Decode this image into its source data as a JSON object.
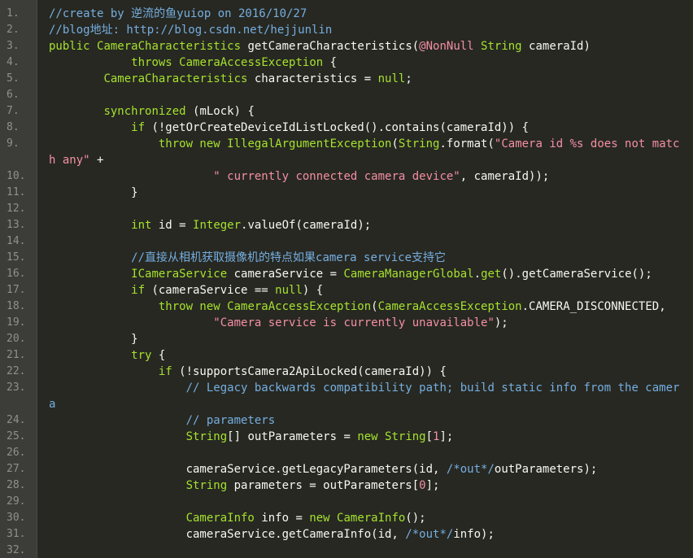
{
  "editor": {
    "line_numbers": [
      "1.",
      "2.",
      "3.",
      "4.",
      "5.",
      "6.",
      "7.",
      "8.",
      "9.",
      "",
      "10.",
      "11.",
      "12.",
      "13.",
      "14.",
      "15.",
      "16.",
      "17.",
      "18.",
      "19.",
      "20.",
      "21.",
      "22.",
      "23.",
      "",
      "24.",
      "25.",
      "26.",
      "27.",
      "28.",
      "29.",
      "30.",
      "31.",
      "32."
    ],
    "lines": [
      [
        {
          "t": "cm",
          "v": "//create by 逆流的鱼yuiop on 2016/10/27"
        }
      ],
      [
        {
          "t": "cm",
          "v": "//blog地址: http://blog.csdn.net/hejjunlin"
        }
      ],
      [
        {
          "t": "kw",
          "v": "public "
        },
        {
          "t": "ty",
          "v": "CameraCharacteristics "
        },
        {
          "t": "pl",
          "v": "getCameraCharacteristics("
        },
        {
          "t": "an",
          "v": "@NonNull"
        },
        {
          "t": "ty",
          "v": " String"
        },
        {
          "t": "pl",
          "v": " cameraId)"
        }
      ],
      [
        {
          "t": "pl",
          "v": "            "
        },
        {
          "t": "kw",
          "v": "throws "
        },
        {
          "t": "ty",
          "v": "CameraAccessException"
        },
        {
          "t": "pl",
          "v": " {"
        }
      ],
      [
        {
          "t": "pl",
          "v": "        "
        },
        {
          "t": "ty",
          "v": "CameraCharacteristics"
        },
        {
          "t": "pl",
          "v": " characteristics = "
        },
        {
          "t": "kw",
          "v": "null"
        },
        {
          "t": "pl",
          "v": ";"
        }
      ],
      [],
      [
        {
          "t": "pl",
          "v": "        "
        },
        {
          "t": "kw",
          "v": "synchronized"
        },
        {
          "t": "pl",
          "v": " (mLock) {"
        }
      ],
      [
        {
          "t": "pl",
          "v": "            "
        },
        {
          "t": "kw",
          "v": "if"
        },
        {
          "t": "pl",
          "v": " (!getOrCreateDeviceIdListLocked().contains(cameraId)) {"
        }
      ],
      [
        {
          "t": "pl",
          "v": "                "
        },
        {
          "t": "kw",
          "v": "throw new "
        },
        {
          "t": "ty",
          "v": "IllegalArgumentException"
        },
        {
          "t": "pl",
          "v": "("
        },
        {
          "t": "ty",
          "v": "String"
        },
        {
          "t": "pl",
          "v": ".format("
        },
        {
          "t": "st",
          "v": "\"Camera id %s does not matc"
        }
      ],
      [
        {
          "t": "st",
          "v": "h any\""
        },
        {
          "t": "pl",
          "v": " +"
        }
      ],
      [
        {
          "t": "pl",
          "v": "                        "
        },
        {
          "t": "st",
          "v": "\" currently connected camera device\""
        },
        {
          "t": "pl",
          "v": ", cameraId));"
        }
      ],
      [
        {
          "t": "pl",
          "v": "            }"
        }
      ],
      [],
      [
        {
          "t": "pl",
          "v": "            "
        },
        {
          "t": "kw",
          "v": "int"
        },
        {
          "t": "pl",
          "v": " id = "
        },
        {
          "t": "ty",
          "v": "Integer"
        },
        {
          "t": "pl",
          "v": ".valueOf(cameraId);"
        }
      ],
      [],
      [
        {
          "t": "pl",
          "v": "            "
        },
        {
          "t": "cm",
          "v": "//直接从相机获取摄像机的特点如果camera service支持它"
        }
      ],
      [
        {
          "t": "pl",
          "v": "            "
        },
        {
          "t": "ty",
          "v": "ICameraService"
        },
        {
          "t": "pl",
          "v": " cameraService = "
        },
        {
          "t": "ty",
          "v": "CameraManagerGlobal"
        },
        {
          "t": "pl",
          "v": "."
        },
        {
          "t": "kw",
          "v": "get"
        },
        {
          "t": "pl",
          "v": "().getCameraService();"
        }
      ],
      [
        {
          "t": "pl",
          "v": "            "
        },
        {
          "t": "kw",
          "v": "if"
        },
        {
          "t": "pl",
          "v": " (cameraService == "
        },
        {
          "t": "kw",
          "v": "null"
        },
        {
          "t": "pl",
          "v": ") {"
        }
      ],
      [
        {
          "t": "pl",
          "v": "                "
        },
        {
          "t": "kw",
          "v": "throw new "
        },
        {
          "t": "ty",
          "v": "CameraAccessException"
        },
        {
          "t": "pl",
          "v": "("
        },
        {
          "t": "ty",
          "v": "CameraAccessException"
        },
        {
          "t": "pl",
          "v": ".CAMERA_DISCONNECTED,"
        }
      ],
      [
        {
          "t": "pl",
          "v": "                        "
        },
        {
          "t": "st",
          "v": "\"Camera service is currently unavailable\""
        },
        {
          "t": "pl",
          "v": ");"
        }
      ],
      [
        {
          "t": "pl",
          "v": "            }"
        }
      ],
      [
        {
          "t": "pl",
          "v": "            "
        },
        {
          "t": "kw",
          "v": "try"
        },
        {
          "t": "pl",
          "v": " {"
        }
      ],
      [
        {
          "t": "pl",
          "v": "                "
        },
        {
          "t": "kw",
          "v": "if"
        },
        {
          "t": "pl",
          "v": " (!supportsCamera2ApiLocked(cameraId)) {"
        }
      ],
      [
        {
          "t": "pl",
          "v": "                    "
        },
        {
          "t": "cm",
          "v": "// Legacy backwards compatibility path; build static info from the camer"
        }
      ],
      [
        {
          "t": "cm",
          "v": "a"
        }
      ],
      [
        {
          "t": "pl",
          "v": "                    "
        },
        {
          "t": "cm",
          "v": "// parameters"
        }
      ],
      [
        {
          "t": "pl",
          "v": "                    "
        },
        {
          "t": "ty",
          "v": "String"
        },
        {
          "t": "pl",
          "v": "[] outParameters = "
        },
        {
          "t": "kw",
          "v": "new "
        },
        {
          "t": "ty",
          "v": "String"
        },
        {
          "t": "pl",
          "v": "["
        },
        {
          "t": "nu",
          "v": "1"
        },
        {
          "t": "pl",
          "v": "];"
        }
      ],
      [],
      [
        {
          "t": "pl",
          "v": "                    cameraService.getLegacyParameters(id, "
        },
        {
          "t": "cm",
          "v": "/*out*/"
        },
        {
          "t": "pl",
          "v": "outParameters);"
        }
      ],
      [
        {
          "t": "pl",
          "v": "                    "
        },
        {
          "t": "ty",
          "v": "String"
        },
        {
          "t": "pl",
          "v": " parameters = outParameters["
        },
        {
          "t": "nu",
          "v": "0"
        },
        {
          "t": "pl",
          "v": "];"
        }
      ],
      [],
      [
        {
          "t": "pl",
          "v": "                    "
        },
        {
          "t": "ty",
          "v": "CameraInfo"
        },
        {
          "t": "pl",
          "v": " info = "
        },
        {
          "t": "kw",
          "v": "new "
        },
        {
          "t": "ty",
          "v": "CameraInfo"
        },
        {
          "t": "pl",
          "v": "();"
        }
      ],
      [
        {
          "t": "pl",
          "v": "                    cameraService.getCameraInfo(id, "
        },
        {
          "t": "cm",
          "v": "/*out*/"
        },
        {
          "t": "pl",
          "v": "info);"
        }
      ],
      []
    ]
  }
}
